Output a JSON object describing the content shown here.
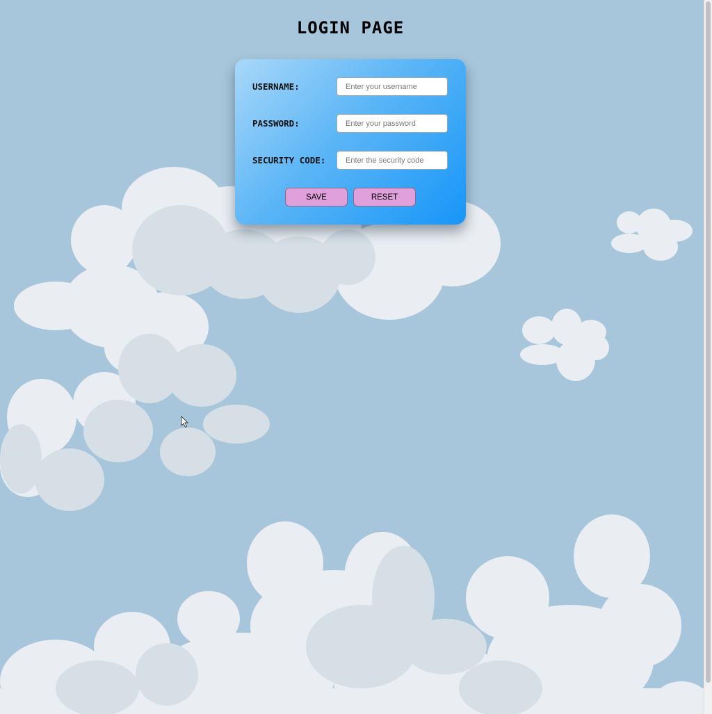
{
  "page": {
    "title": "LOGIN PAGE"
  },
  "form": {
    "username": {
      "label": "USERNAME:",
      "placeholder": "Enter your username",
      "value": ""
    },
    "password": {
      "label": "PASSWORD:",
      "placeholder": "Enter your password",
      "value": ""
    },
    "security_code": {
      "label": "SECURITY CODE:",
      "placeholder": "Enter the security code",
      "value": ""
    },
    "save_label": "SAVE",
    "reset_label": "RESET"
  },
  "colors": {
    "background": "#a7c6db",
    "card_gradient_start": "#a9d8f9",
    "card_gradient_end": "#1796f8",
    "button": "#dfa0dc",
    "cloud_light": "#e9edf1",
    "cloud_shadow": "#d6dfe6"
  },
  "icons": {
    "cursor": "arrow-cursor-icon"
  }
}
